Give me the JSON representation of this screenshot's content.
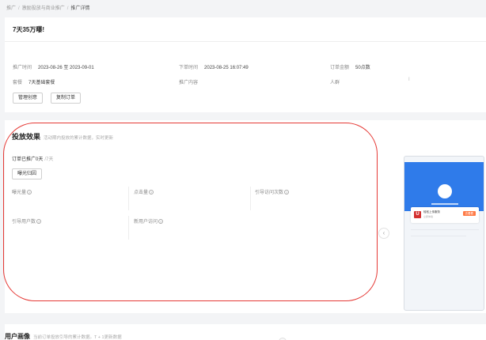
{
  "breadcrumb": {
    "items": [
      "推广",
      "激励投放与商业推广",
      "推广详情"
    ],
    "separator": "/"
  },
  "order": {
    "title": "7天35万曝!",
    "promo_time_label": "推广时间",
    "promo_time_value": "2023-08-26 至 2023-09-01",
    "order_time_label": "下单时间",
    "order_time_value": "2023-08-25 16:07:49",
    "amount_label": "订单金额",
    "amount_value": "50点数",
    "package_label": "套餐",
    "package_value": "7天基础套餐",
    "content_label": "推广内容",
    "audience_label": "人群",
    "audience_value": "I",
    "manage_button": "管理创意",
    "copy_button": "复制订单"
  },
  "effect": {
    "title": "投放效果",
    "subtitle": "活动期内投放的累计数据，实时更新",
    "promoted_label": "订单已推广0天",
    "promoted_total": "/7天",
    "attribution_button": "曝光归因",
    "metrics": [
      "曝光量",
      "点击量",
      "引导访问次数",
      "引导用户数",
      "新用户访问"
    ]
  },
  "preview": {
    "logo_char": "U",
    "card_title": "轻松上传服务",
    "card_sub": "立即体验",
    "cta": "去看看"
  },
  "portrait": {
    "title": "用户画像",
    "subtitle": "当前订单投放引导的累计数据。T + 1更新数据"
  },
  "colors": {
    "highlight_ellipse": "#e53935",
    "phone_header": "#2f7bea"
  }
}
